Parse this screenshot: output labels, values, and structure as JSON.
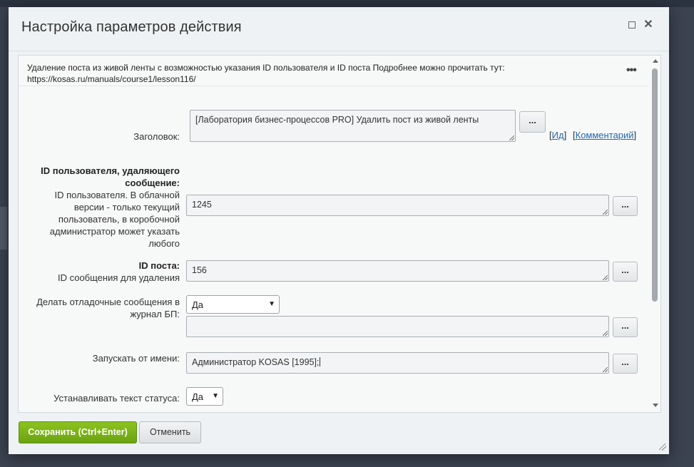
{
  "dialog": {
    "title": "Настройка параметров действия",
    "description": "Удаление поста из живой ленты с возможностью указания ID пользователя и ID поста Подробнее можно прочитать тут: https://kosas.ru/manuals/course1/lesson116/",
    "more_icon": "ellipsis-icon"
  },
  "fields": {
    "header": {
      "label": "Заголовок:",
      "value": "[Лаборатория бизнес-процессов PRO] Удалить пост из живой ленты",
      "button": "...",
      "link_id": "Ид",
      "link_comment": "Комментарий"
    },
    "user_id": {
      "label_bold": "ID пользователя, удаляющего сообщение:",
      "label_hint": "ID пользователя. В облачной версии - только текущий пользователь, в коробочной администратор может указать любого",
      "value": "1245",
      "button": "..."
    },
    "post_id": {
      "label_bold": "ID поста:",
      "label_hint": "ID сообщения для удаления",
      "value": "156",
      "button": "..."
    },
    "debug": {
      "label": "Делать отладочные сообщения в журнал БП:",
      "select_value": "Да",
      "value": "",
      "button": "..."
    },
    "run_as": {
      "label": "Запускать от имени:",
      "value": "Администратор KOSAS [1995];",
      "button": "..."
    },
    "status": {
      "label": "Устанавливать текст статуса:",
      "select_value": "Да"
    }
  },
  "footer": {
    "save_label": "Сохранить (Ctrl+Enter)",
    "cancel_label": "Отменить"
  },
  "colors": {
    "save_green": "#7ab317",
    "link_blue": "#2067b0"
  }
}
